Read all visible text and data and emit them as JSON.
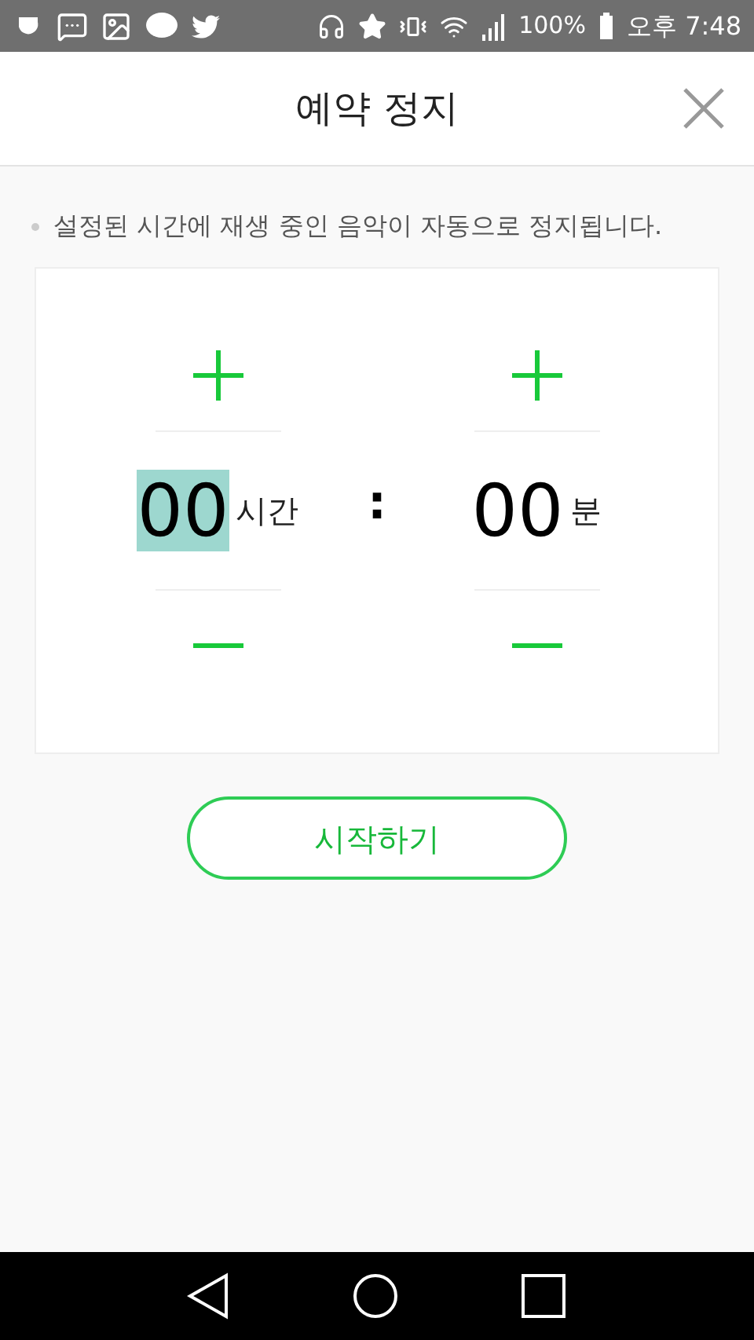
{
  "status_bar": {
    "battery": "100%",
    "time": "오후 7:48"
  },
  "header": {
    "title": "예약 정지"
  },
  "notice": "설정된 시간에 재생 중인 음악이 자동으로 정지됩니다.",
  "timer": {
    "separator": ":",
    "units": [
      {
        "value": "00",
        "label": "시간",
        "selected": true
      },
      {
        "value": "00",
        "label": "분",
        "selected": false
      }
    ]
  },
  "start_button": "시작하기"
}
